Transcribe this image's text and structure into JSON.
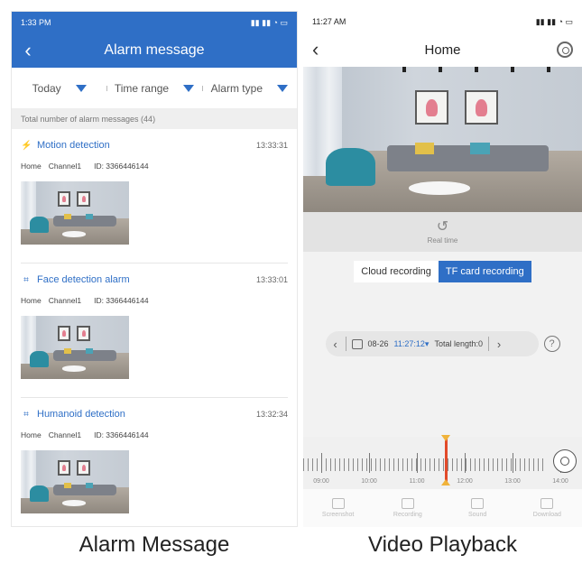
{
  "left": {
    "status_time": "1:33 PM",
    "header_title": "Alarm message",
    "filters": [
      {
        "label": "Today"
      },
      {
        "label": "Time range"
      },
      {
        "label": "Alarm type"
      }
    ],
    "total_text": "Total number of alarm messages (44)",
    "alarms": [
      {
        "type": "Motion detection",
        "time": "13:33:31",
        "device": "Home",
        "channel": "Channel1",
        "id": "ID: 3366446144",
        "icon": "motion-icon"
      },
      {
        "type": "Face detection alarm",
        "time": "13:33:01",
        "device": "Home",
        "channel": "Channel1",
        "id": "ID: 3366446144",
        "icon": "face-icon"
      },
      {
        "type": "Humanoid detection",
        "time": "13:32:34",
        "device": "Home",
        "channel": "Channel1",
        "id": "ID: 3366446144",
        "icon": "humanoid-icon"
      }
    ]
  },
  "right": {
    "status_time": "11:27 AM",
    "header_title": "Home",
    "realtime_label": "Real time",
    "recording_options": [
      {
        "label": "Cloud recording",
        "selected": false
      },
      {
        "label": "TF card recording",
        "selected": true
      }
    ],
    "date": "08-26",
    "time": "11:27:12",
    "total_length": "Total length:0",
    "help_label": "?",
    "timeline_labels": [
      "09:00",
      "10:00",
      "11:00",
      "12:00",
      "13:00",
      "14:00"
    ],
    "tools": [
      {
        "label": "Screenshot"
      },
      {
        "label": "Recording"
      },
      {
        "label": "Sound"
      },
      {
        "label": "Download"
      }
    ]
  },
  "captions": {
    "left": "Alarm Message",
    "right": "Video Playback"
  },
  "colors": {
    "primary": "#2f6fc6",
    "timeline_cursor": "#e24a2a",
    "cursor_caps": "#f0b33a"
  }
}
